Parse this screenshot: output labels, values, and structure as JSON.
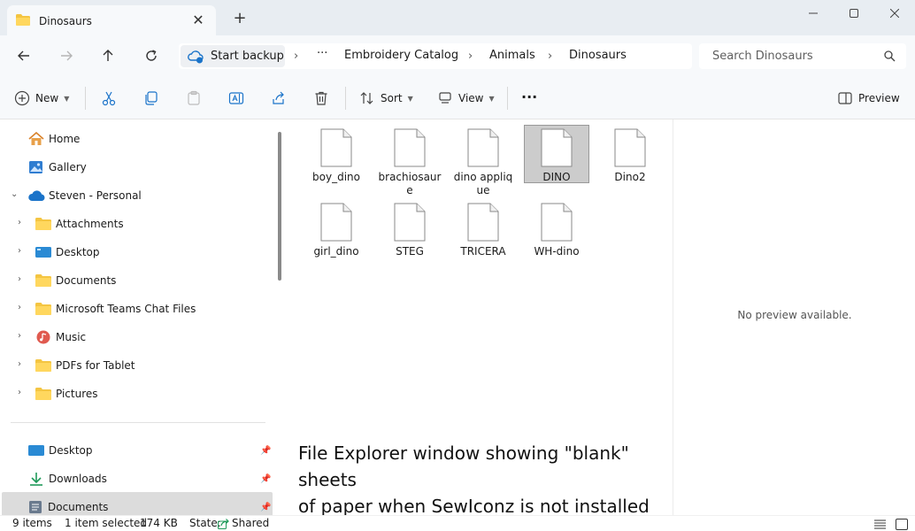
{
  "window": {
    "tab_title": "Dinosaurs",
    "tab_close": "✕",
    "new_tab": "+"
  },
  "address": {
    "backup_label": "Start backup",
    "more": "···",
    "breadcrumbs": [
      "Embroidery Catalog",
      "Animals",
      "Dinosaurs"
    ],
    "search_placeholder": "Search Dinosaurs"
  },
  "commands": {
    "new_label": "New",
    "sort_label": "Sort",
    "view_label": "View",
    "more": "···",
    "preview_label": "Preview"
  },
  "nav": {
    "home": "Home",
    "gallery": "Gallery",
    "account": "Steven - Personal",
    "folders": [
      "Attachments",
      "Desktop",
      "Documents",
      "Microsoft Teams Chat Files",
      "Music",
      "PDFs for Tablet",
      "Pictures"
    ],
    "quick_access": [
      "Desktop",
      "Downloads",
      "Documents"
    ]
  },
  "files": [
    {
      "name": "boy_dino",
      "selected": false
    },
    {
      "name": "brachiosaure",
      "selected": false
    },
    {
      "name": "dino applique",
      "selected": false
    },
    {
      "name": "DINO",
      "selected": true
    },
    {
      "name": "Dino2",
      "selected": false
    },
    {
      "name": "girl_dino",
      "selected": false
    },
    {
      "name": "STEG",
      "selected": false
    },
    {
      "name": "TRICERA",
      "selected": false
    },
    {
      "name": "WH-dino",
      "selected": false
    }
  ],
  "caption": {
    "line1": "File Explorer window showing \"blank\" sheets",
    "line2": "of paper when SewIconz is not installed"
  },
  "preview": {
    "message": "No preview available."
  },
  "status": {
    "count": "9 items",
    "selection": "1 item selected",
    "size": "174 KB",
    "state_label": "State:",
    "state_value": "Shared"
  },
  "colors": {
    "folder": "#f4c542",
    "selection_bg": "#cccccc",
    "accent": "#0067c0"
  }
}
